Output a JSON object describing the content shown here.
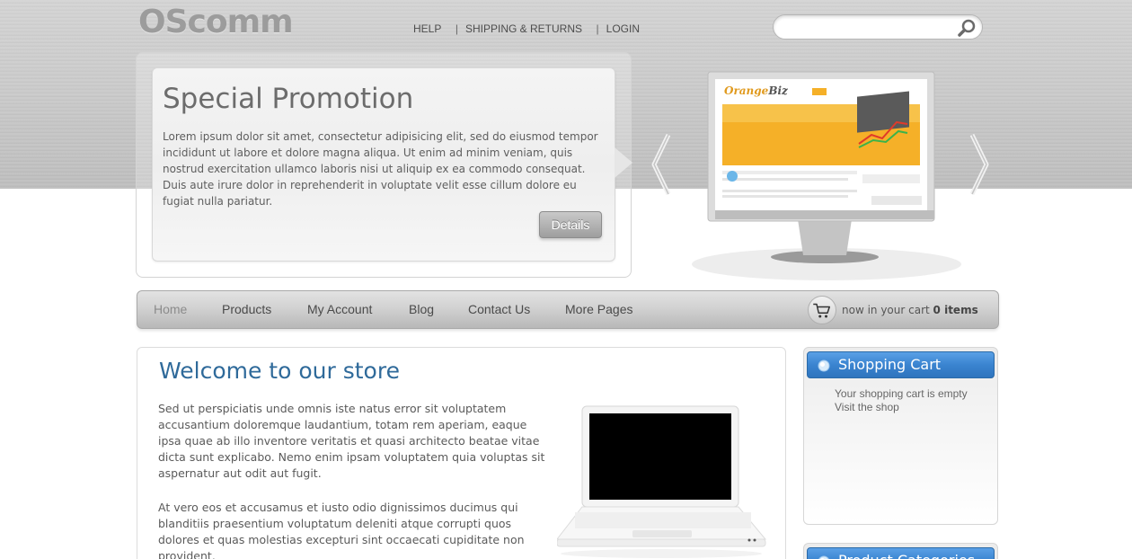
{
  "header": {
    "logo": "OScomm",
    "links": [
      "HELP",
      "SHIPPING & RETURNS",
      "LOGIN"
    ],
    "search": {
      "placeholder": "",
      "icon": "search-icon"
    }
  },
  "promo": {
    "title": "Special Promotion",
    "text": "Lorem ipsum dolor sit amet, consectetur adipisicing elit, sed do eiusmod tempor incididunt ut labore et dolore magna aliqua. Ut enim ad minim veniam, quis nostrud exercitation ullamco laboris nisi ut aliquip ex ea commodo consequat. Duis aute irure dolor in reprehenderit in voluptate velit esse cillum dolore eu fugiat nulla pariatur.",
    "button": "Details"
  },
  "nav": {
    "items": [
      "Home",
      "Products",
      "My Account",
      "Blog",
      "Contact Us",
      "More Pages"
    ],
    "active": "Home",
    "cart_prefix": "now in your cart",
    "cart_count": "0 items"
  },
  "main": {
    "title": "Welcome to our store",
    "paragraphs": [
      "Sed ut perspiciatis unde omnis iste natus error sit voluptatem accusantium doloremque laudantium, totam rem aperiam, eaque ipsa quae ab illo inventore veritatis et quasi architecto beatae vitae dicta sunt explicabo. Nemo enim ipsam voluptatem quia voluptas sit aspernatur aut odit aut fugit.",
      "At vero eos et accusamus et iusto odio dignissimos ducimus qui blanditiis praesentium voluptatum deleniti atque corrupti quos dolores et quas molestias excepturi sint occaecati cupiditate non provident,"
    ]
  },
  "sidebar": {
    "cart_title": "Shopping Cart",
    "cart_empty": "Your shopping cart is empty",
    "cart_link": "Visit the shop",
    "categories_title": "Product Categories"
  },
  "colors": {
    "title_blue": "#2f6a9a",
    "side_header_blue": "#3a84d0"
  }
}
